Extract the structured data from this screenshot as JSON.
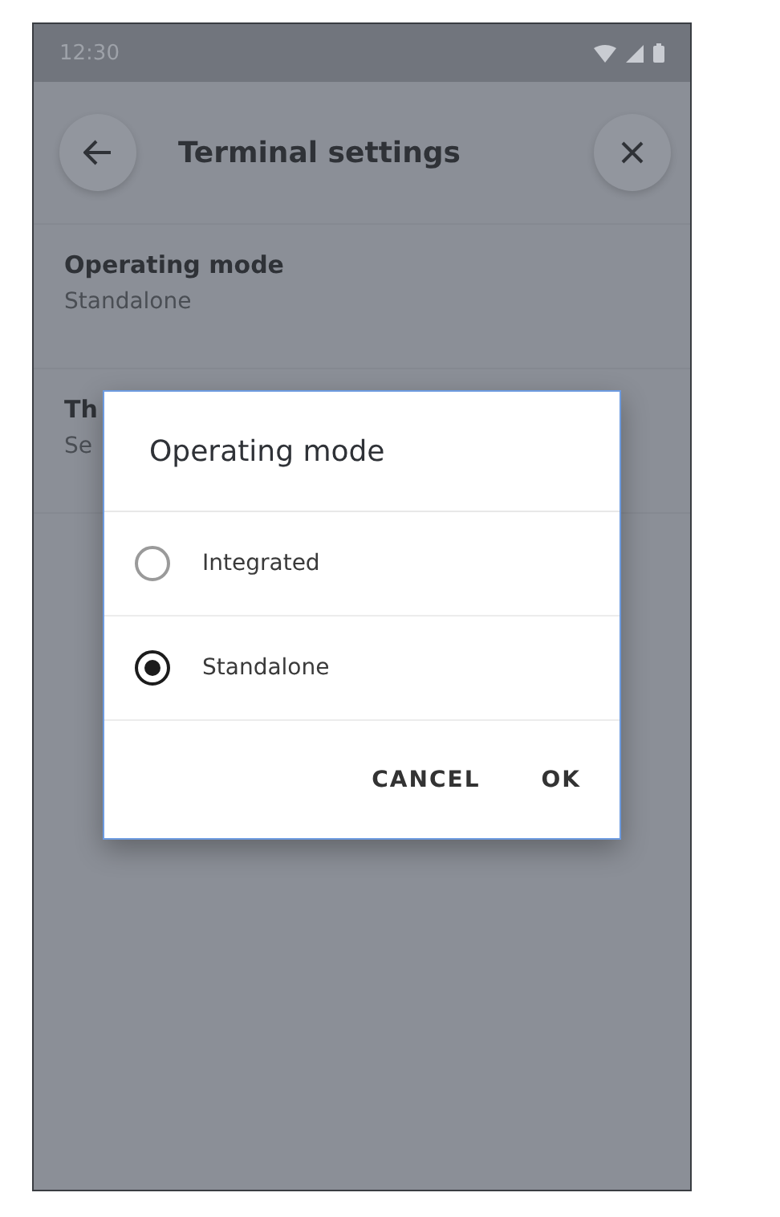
{
  "status_bar": {
    "time": "12:30"
  },
  "header": {
    "title": "Terminal settings"
  },
  "settings": [
    {
      "label": "Operating mode",
      "value": "Standalone"
    },
    {
      "label": "Th",
      "value": "Se"
    }
  ],
  "dialog": {
    "title": "Operating mode",
    "options": [
      {
        "label": "Integrated",
        "selected": false
      },
      {
        "label": "Standalone",
        "selected": true
      }
    ],
    "buttons": [
      "CANCEL",
      "OK"
    ]
  }
}
